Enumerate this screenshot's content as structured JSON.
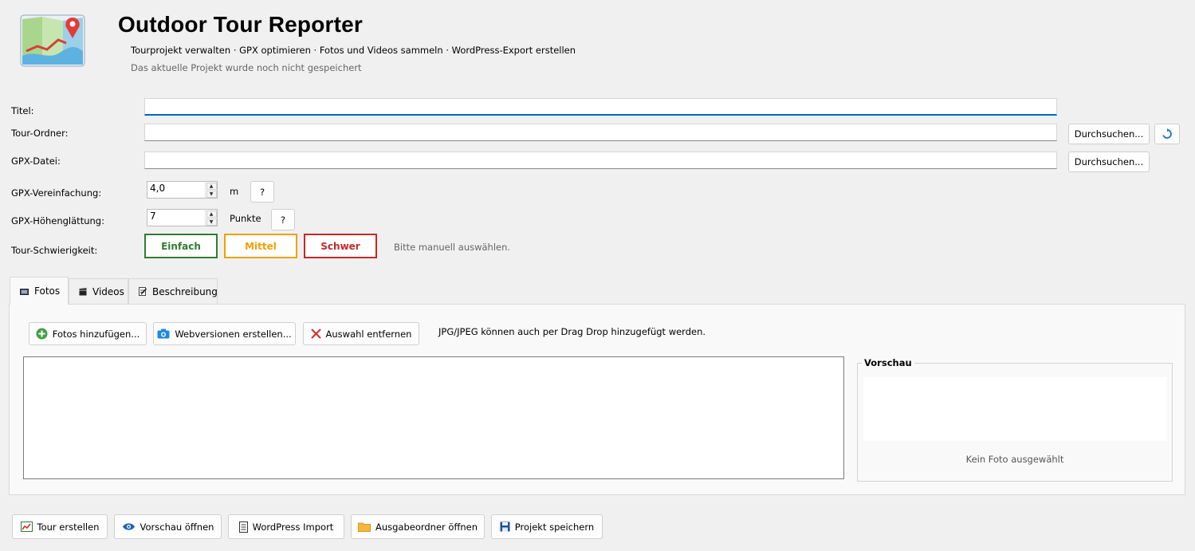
{
  "header": {
    "title": "Outdoor Tour Reporter",
    "subtitle": "Tourprojekt verwalten · GPX optimieren · Fotos und Videos sammeln · WordPress-Export erstellen",
    "status": "Das aktuelle Projekt wurde noch nicht gespeichert"
  },
  "form": {
    "title_label": "Titel:",
    "title_value": "",
    "tour_folder_label": "Tour-Ordner:",
    "tour_folder_value": "",
    "gpx_file_label": "GPX-Datei:",
    "gpx_file_value": "",
    "browse_label": "Durchsuchen...",
    "simplify_label": "GPX-Vereinfachung:",
    "simplify_value": "4,0",
    "simplify_unit": "m",
    "smoothing_label": "GPX-Höhenglättung:",
    "smoothing_value": "7",
    "smoothing_unit": "Punkte",
    "help_label": "?",
    "difficulty_label": "Tour-Schwierigkeit:",
    "difficulty_easy": "Einfach",
    "difficulty_medium": "Mittel",
    "difficulty_hard": "Schwer",
    "difficulty_hint": "Bitte manuell auswählen."
  },
  "colors": {
    "easy": "#2e7d32",
    "medium": "#f0a000",
    "hard": "#c62828",
    "accent": "#0067c0"
  },
  "tabs": [
    {
      "label": "Fotos",
      "icon": "photo-icon"
    },
    {
      "label": "Videos",
      "icon": "clapperboard-icon"
    },
    {
      "label": "Beschreibung",
      "icon": "edit-icon"
    }
  ],
  "photos": {
    "add_label": "Fotos hinzufügen...",
    "web_label": "Webversionen erstellen...",
    "remove_label": "Auswahl entfernen",
    "drop_hint": "JPG/JPEG können auch per Drag  Drop hinzugefügt werden.",
    "preview_title": "Vorschau",
    "no_photo": "Kein Foto ausgewählt"
  },
  "actions": {
    "create_tour": "Tour erstellen",
    "open_preview": "Vorschau öffnen",
    "wordpress_import": "WordPress Import",
    "open_output": "Ausgabeordner öffnen",
    "save_project": "Projekt speichern"
  }
}
